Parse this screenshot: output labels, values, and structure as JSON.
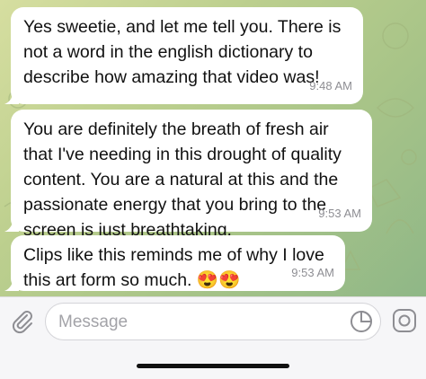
{
  "messages": [
    {
      "lines": [
        "Yes sweetie, and let me tell you. There is",
        "not a word in the english dictionary to",
        "describe how amazing that video was!"
      ],
      "time": "9:48 AM"
    },
    {
      "lines": [
        "You are definitely the breath of fresh air",
        "that I've needing in this drought of quality",
        "content. You are a natural at this and the",
        "passionate energy that you bring to the",
        "screen is just breathtaking."
      ],
      "time": "9:53 AM"
    },
    {
      "lines": [
        "Clips like this reminds me of why I love",
        "this art form so much. 😍😍"
      ],
      "time": "9:53 AM"
    }
  ],
  "composer": {
    "placeholder": "Message"
  },
  "icons": {
    "attach": "paperclip-icon",
    "sticker": "sticker-icon",
    "camera": "camera-icon"
  },
  "colors": {
    "wallpaper": "#bccf8e",
    "bubble": "#ffffff",
    "timestamp": "#8e8e93"
  }
}
